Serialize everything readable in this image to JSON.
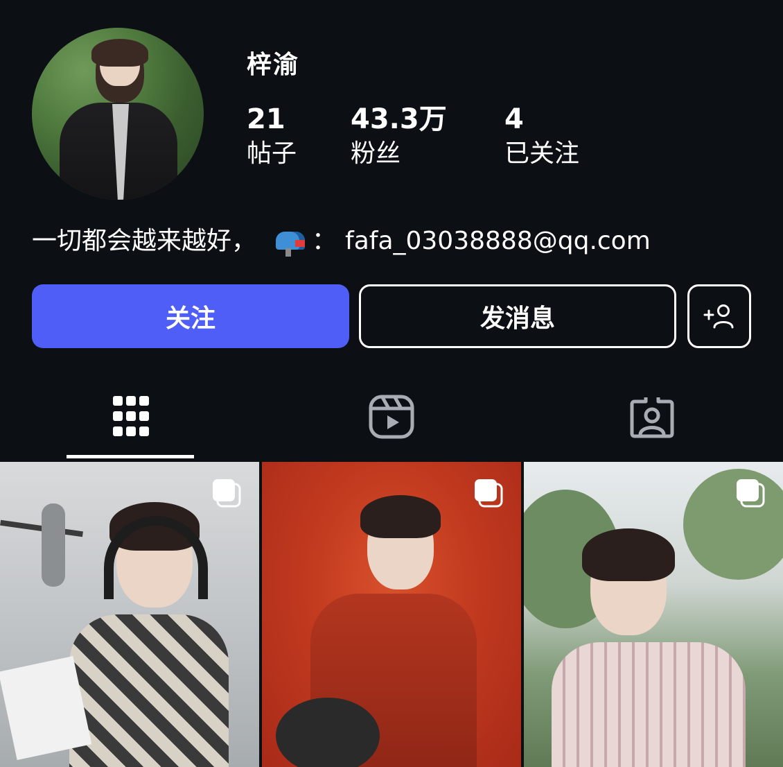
{
  "profile": {
    "username": "梓渝",
    "stats": [
      {
        "value": "21",
        "label": "帖子"
      },
      {
        "value": "43.3万",
        "label": "粉丝"
      },
      {
        "value": "4",
        "label": "已关注"
      }
    ],
    "bio_text": "一切都会越来越好，",
    "bio_separator": "：",
    "bio_email": "fafa_03038888@qq.com"
  },
  "actions": {
    "follow_label": "关注",
    "message_label": "发消息",
    "add_user_icon": "add-user-icon"
  },
  "tabs": [
    {
      "icon": "grid-icon",
      "active": true
    },
    {
      "icon": "reels-icon",
      "active": false
    },
    {
      "icon": "tagged-icon",
      "active": false
    }
  ],
  "posts": [
    {
      "type": "carousel",
      "icon": "multi-image-icon"
    },
    {
      "type": "carousel",
      "icon": "multi-image-icon"
    },
    {
      "type": "carousel",
      "icon": "multi-image-icon"
    }
  ],
  "colors": {
    "background": "#0c0f14",
    "accent": "#4f5ef6",
    "text": "#ffffff"
  }
}
